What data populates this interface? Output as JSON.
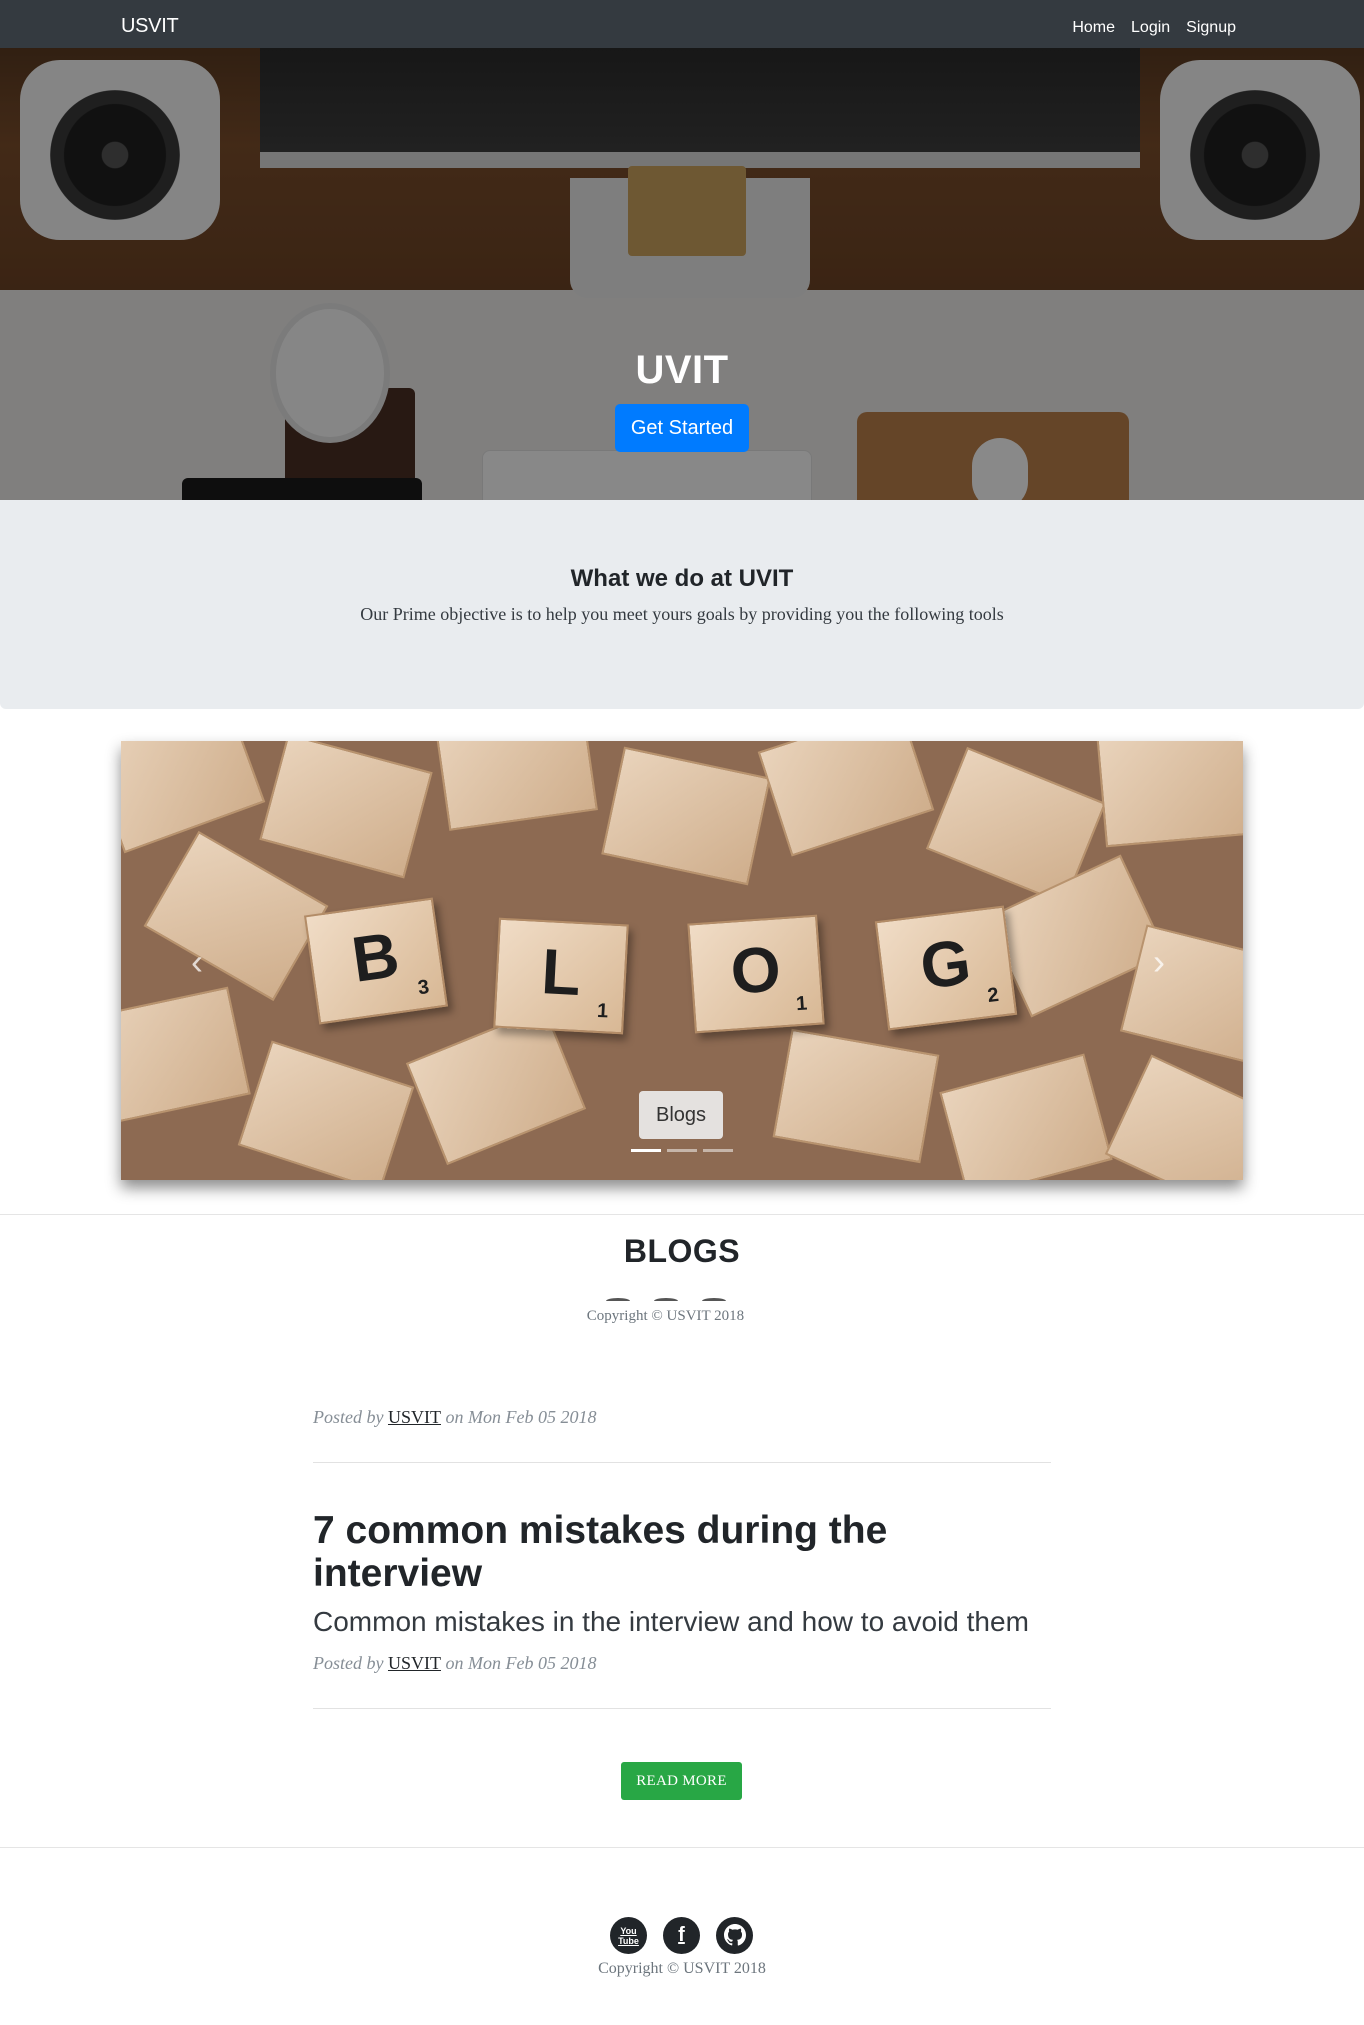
{
  "navbar": {
    "brand": "USVIT",
    "links": [
      "Home",
      "Login",
      "Signup"
    ]
  },
  "hero": {
    "title": "UVIT",
    "button_label": "Get Started"
  },
  "what_we_do": {
    "title": "What we do at UVIT",
    "text": "Our Prime objective is to help you meet yours goals by providing you the following tools"
  },
  "carousel": {
    "letters": [
      {
        "letter": "B",
        "sub": "3"
      },
      {
        "letter": "L",
        "sub": "1"
      },
      {
        "letter": "O",
        "sub": "1"
      },
      {
        "letter": "G",
        "sub": "2"
      }
    ],
    "caption": "Blogs",
    "prev_icon": "chevron-left-icon",
    "next_icon": "chevron-right-icon",
    "active_slide": 1,
    "slide_count": 3
  },
  "blogs": {
    "title": "BLOGS",
    "copyright_small": "Copyright © USVIT 2018",
    "posts": [
      {
        "posted_by": "Posted by",
        "author": "USVIT",
        "on": "on",
        "date": "Mon Feb 05 2018"
      },
      {
        "title": "7 common mistakes during the interview",
        "subtitle": "Common mistakes in the interview and how to avoid them",
        "posted_by": "Posted by",
        "author": "USVIT",
        "on": "on",
        "date": "Mon Feb 05 2018"
      }
    ],
    "read_more": "READ MORE"
  },
  "footer": {
    "social_icons": [
      "youtube-icon",
      "facebook-icon",
      "github-icon"
    ],
    "youtube_label": "You Tube",
    "copyright": "Copyright © USVIT 2018"
  },
  "colors": {
    "navbar": "#343a40",
    "primary": "#007bff",
    "success": "#28a745",
    "jumbotron": "#e9ecef"
  }
}
